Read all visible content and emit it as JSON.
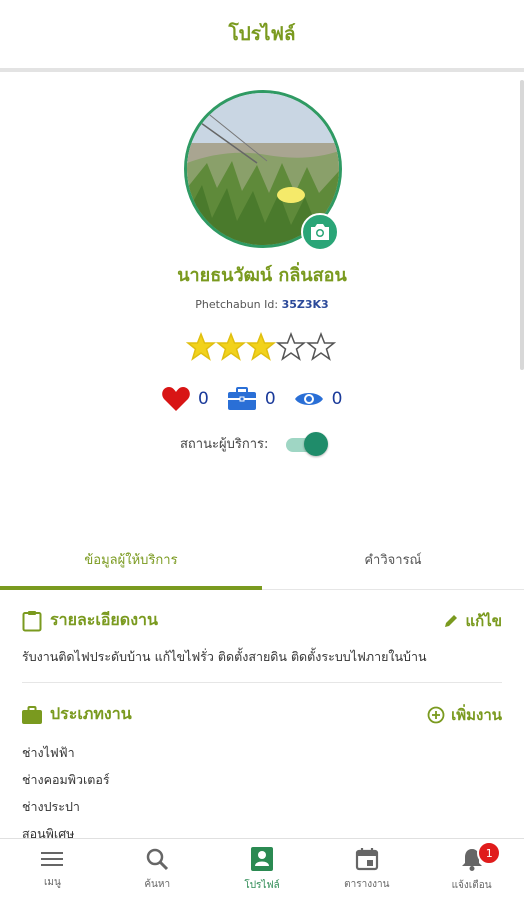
{
  "header": {
    "title": "โปรไฟล์"
  },
  "profile": {
    "name": "นายธนวัฒน์  กลิ่นสอน",
    "id_label": "Phetchabun Id:",
    "id_value": "35Z3K3",
    "rating": 3,
    "rating_max": 5,
    "likes": "0",
    "jobs": "0",
    "views": "0",
    "status_label": "สถานะผู้บริการ:",
    "status_on": true
  },
  "tabs": [
    {
      "label": "ข้อมูลผู้ให้บริการ",
      "active": true
    },
    {
      "label": "คำวิจารณ์",
      "active": false
    }
  ],
  "job_detail": {
    "title": "รายละเอียดงาน",
    "action": "แก้ไข",
    "text": "รับงานติดไฟประดับบ้าน แก้ไขไฟรั่ว ติดตั้งสายดิน ติดตั้งระบบไฟภายในบ้าน"
  },
  "job_types": {
    "title": "ประเภทงาน",
    "action": "เพิ่มงาน",
    "items": [
      "ช่างไฟฟ้า",
      "ช่างคอมพิวเตอร์",
      "ช่างประปา",
      "สอนพิเศษ"
    ]
  },
  "bottom_nav": [
    {
      "label": "เมนู",
      "icon": "menu-icon"
    },
    {
      "label": "ค้นหา",
      "icon": "search-icon"
    },
    {
      "label": "โปรไฟล์",
      "icon": "profile-icon",
      "active": true
    },
    {
      "label": "ตารางงาน",
      "icon": "calendar-icon"
    },
    {
      "label": "แจ้งเตือน",
      "icon": "bell-icon",
      "badge": "1"
    }
  ],
  "colors": {
    "brand": "#7a9a1f",
    "accent_green": "#2aa577",
    "star": "#f2d21b",
    "link_blue": "#1a3a9a",
    "badge_red": "#e01c1c"
  }
}
